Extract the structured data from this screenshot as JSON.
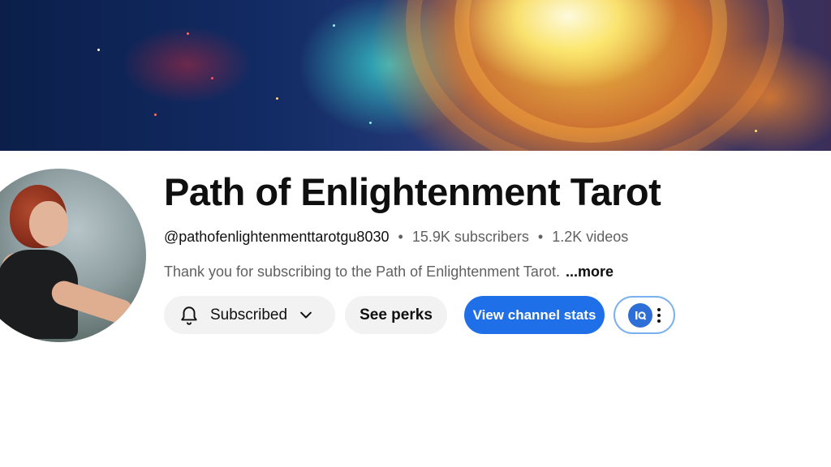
{
  "channel": {
    "title": "Path of Enlightenment Tarot",
    "handle": "@pathofenlightenmenttarotgu8030",
    "separator": "•",
    "subscribers": "15.9K subscribers",
    "videos": "1.2K videos",
    "description": "Thank you for subscribing to the Path of Enlightenment Tarot.",
    "more_label": "...more"
  },
  "actions": {
    "subscribed_label": "Subscribed",
    "perks_label": "See perks",
    "stats_label": "View channel stats",
    "extension_icon": "vidiq-icon"
  },
  "icons": {
    "bell": "bell-icon",
    "chevron": "chevron-down-icon",
    "more": "more-vertical-icon"
  },
  "colors": {
    "stats_button": "#1f6fe8",
    "chip_background": "#f2f2f2",
    "secondary_text": "#606060"
  }
}
